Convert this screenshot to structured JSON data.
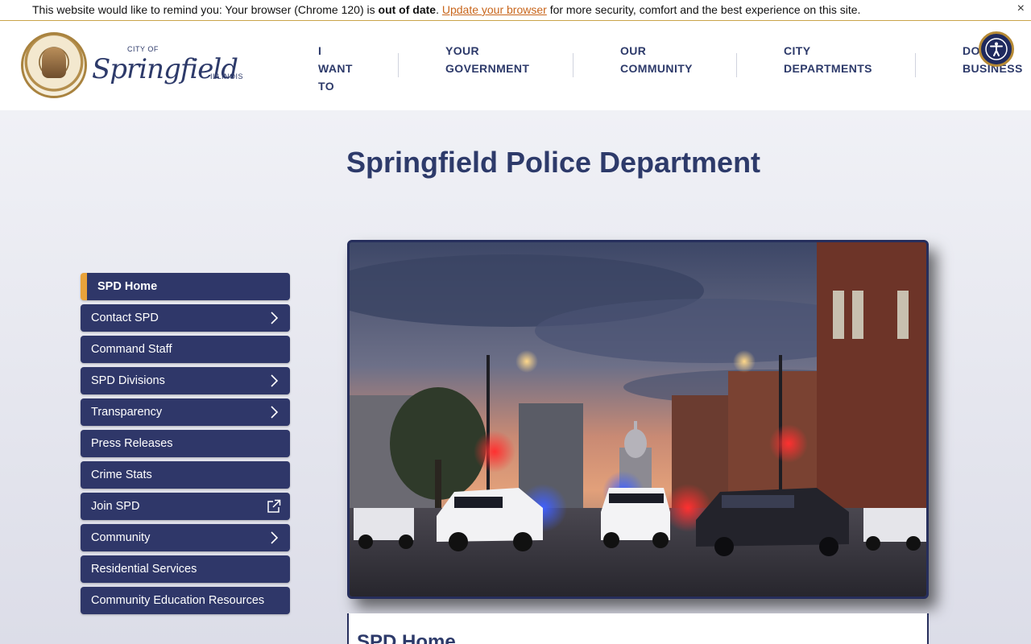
{
  "banner": {
    "text_prefix": "This website would like to remind you: Your browser (Chrome 120) is ",
    "text_bold": "out of date",
    "text_dot": ". ",
    "link": "Update your browser",
    "text_suffix": " for more security, comfort and the best experience on this site.",
    "close": "×"
  },
  "logo": {
    "city_of": "CITY OF",
    "name": "Springfield",
    "state": "ILLINOIS"
  },
  "nav": {
    "items": [
      {
        "label": "I\nWANT\nTO"
      },
      {
        "label": "YOUR\nGOVERNMENT"
      },
      {
        "label": "OUR\nCOMMUNITY"
      },
      {
        "label": "CITY\nDEPARTMENTS"
      },
      {
        "label": "DOING\nBUSINESS"
      }
    ]
  },
  "page": {
    "title": "Springfield Police Department",
    "content_heading": "SPD Home"
  },
  "side_nav": {
    "items": [
      {
        "label": "SPD Home"
      },
      {
        "label": "Contact SPD"
      },
      {
        "label": "Command Staff"
      },
      {
        "label": "SPD Divisions"
      },
      {
        "label": "Transparency"
      },
      {
        "label": "Press Releases"
      },
      {
        "label": "Crime Stats"
      },
      {
        "label": "Join SPD"
      },
      {
        "label": "Community"
      },
      {
        "label": "Residential Services"
      },
      {
        "label": "Community Education Resources"
      }
    ]
  },
  "colors": {
    "brand_navy": "#2d3a6a",
    "nav_button": "#2f3769",
    "accent_gold": "#e8a23a",
    "link_orange": "#c8651b"
  }
}
